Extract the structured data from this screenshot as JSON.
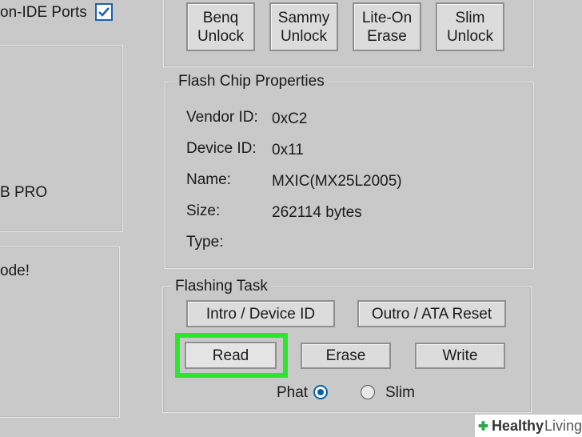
{
  "left_panel": {
    "ports_label": "on-IDE Ports",
    "ports_checked": true,
    "model_text": "B PRO",
    "mode_text": "ode!"
  },
  "unlock_buttons": [
    {
      "label": "Benq\nUnlock"
    },
    {
      "label": "Sammy\nUnlock"
    },
    {
      "label": "Lite-On\nErase"
    },
    {
      "label": "Slim\nUnlock"
    }
  ],
  "flash_chip": {
    "title": "Flash Chip Properties",
    "rows": [
      {
        "label": "Vendor ID:",
        "value": "0xC2"
      },
      {
        "label": "Device ID:",
        "value": "0x11"
      },
      {
        "label": "Name:",
        "value": "MXIC(MX25L2005)"
      },
      {
        "label": "Size:",
        "value": "262114 bytes"
      },
      {
        "label": "Type:",
        "value": ""
      }
    ]
  },
  "flashing_task": {
    "title": "Flashing Task",
    "intro_button": "Intro / Device ID",
    "outro_button": "Outro / ATA Reset",
    "read_button": "Read",
    "erase_button": "Erase",
    "write_button": "Write",
    "radio_phat": "Phat",
    "radio_slim": "Slim",
    "selected": "Phat",
    "highlight_color": "#2CE62C"
  },
  "watermark": {
    "brand": "Healthy",
    "brand_suffix": "Living"
  }
}
